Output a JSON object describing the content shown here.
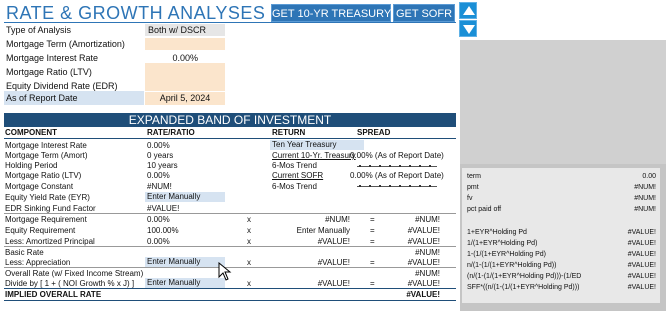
{
  "header": {
    "title": "RATE & GROWTH ANALYSES",
    "btn_treasury": "GET 10-YR TREASURY",
    "btn_sofr": "GET SOFR"
  },
  "inputs": {
    "type_label": "Type of Analysis",
    "type_value": "Both w/ DSCR",
    "term_label": "Mortgage Term (Amortization)",
    "rate_label": "Mortgage Interest Rate",
    "rate_value": "0.00%",
    "ltv_label": "Mortgage Ratio (LTV)",
    "edr_label": "Equity Dividend Rate (EDR)",
    "date_label": "As of Report Date",
    "date_value": "April 5, 2024"
  },
  "band": {
    "title": "EXPANDED BAND OF INVESTMENT",
    "col_component": "COMPONENT",
    "col_rate": "RATE/RATIO",
    "col_return": "RETURN",
    "col_spread": "SPREAD"
  },
  "rows": {
    "r1_label": "Mortgage Interest Rate",
    "r1_rate": "0.00%",
    "r2_label": "Mortgage Term (Amort)",
    "r2_rate": "0 years",
    "r3_label": "Holding Period",
    "r3_rate": "10 years",
    "r4_label": "Mortgage Ratio (LTV)",
    "r4_rate": "0.00%",
    "r5_label": "Mortgage Constant",
    "r5_rate": "#NUM!",
    "r6_label": "Equity Yield Rate (EYR)",
    "r6_rate": "Enter Manually",
    "r7_label": "EDR Sinking Fund Factor",
    "r7_rate": "#VALUE!",
    "r8_label": "Mortgage Requirement",
    "r8_rate": "0.00%",
    "r8_x": "x",
    "r8_mid": "#NUM!",
    "r8_eq": "=",
    "r8_res": "#NUM!",
    "r9_label": "Equity Requirement",
    "r9_rate": "100.00%",
    "r9_x": "x",
    "r9_mid": "Enter Manually",
    "r9_eq": "=",
    "r9_res": "#VALUE!",
    "r10_label": "Less: Amortized Principal",
    "r10_rate": "0.00%",
    "r10_x": "x",
    "r10_mid": "#VALUE!",
    "r10_eq": "=",
    "r10_res": "#VALUE!",
    "r11_label": "Basic Rate",
    "r11_res": "#NUM!",
    "r12_label": "Less: Appreciation",
    "r12_rate": "Enter Manually",
    "r12_x": "x",
    "r12_mid": "#VALUE!",
    "r12_eq": "=",
    "r12_res": "#VALUE!",
    "r13_label": "Overall Rate (w/ Fixed Income Stream)",
    "r13_res": "#NUM!",
    "r14_label": "Divide by [ 1 + ( NOI Growth % x J) ]",
    "r14_rate": "Enter Manually",
    "r14_x": "x",
    "r14_mid": "#VALUE!",
    "r14_eq": "=",
    "r14_res": "#VALUE!",
    "r15_label": "IMPLIED OVERALL RATE",
    "r15_res": "#VALUE!"
  },
  "returns": {
    "ten_year": "Ten Year Treasury",
    "current_10yr": "Current 10-Yr. Treasury",
    "current_10yr_val": "0.00% (As of Report Date)",
    "trend1": "6-Mos Trend",
    "current_sofr": "Current SOFR",
    "current_sofr_val": "0.00% (As of Report Date)",
    "trend2": "6-Mos Trend"
  },
  "side_panel": {
    "top": [
      {
        "label": "term",
        "value": "0.00"
      },
      {
        "label": "pmt",
        "value": "#NUM!"
      },
      {
        "label": "fv",
        "value": "#NUM!"
      },
      {
        "label": "pct paid off",
        "value": "#NUM!"
      }
    ],
    "bottom": [
      {
        "label": "1+EYR^Holding Pd",
        "value": "#VALUE!"
      },
      {
        "label": "1/(1+EYR^Holding Pd)",
        "value": "#VALUE!"
      },
      {
        "label": "1-(1/(1+EYR^Holding Pd)",
        "value": "#VALUE!"
      },
      {
        "label": "n/(1-(1/(1+EYR^Holding Pd))",
        "value": "#VALUE!"
      },
      {
        "label": "(n/(1-(1/(1+EYR^Holding Pd)))-(1/ED",
        "value": "#VALUE!"
      },
      {
        "label": "SFF*((n/(1-(1/(1+EYR^Holding Pd)))",
        "value": "#VALUE!"
      }
    ]
  },
  "colors": {
    "accent": "#2e75b6",
    "band": "#1f4e79",
    "input_peach": "#fbe5cc",
    "input_blue": "#d6e3f1",
    "scroll_button": "#1a8fd6",
    "side_panel": "#c5c5c5"
  }
}
